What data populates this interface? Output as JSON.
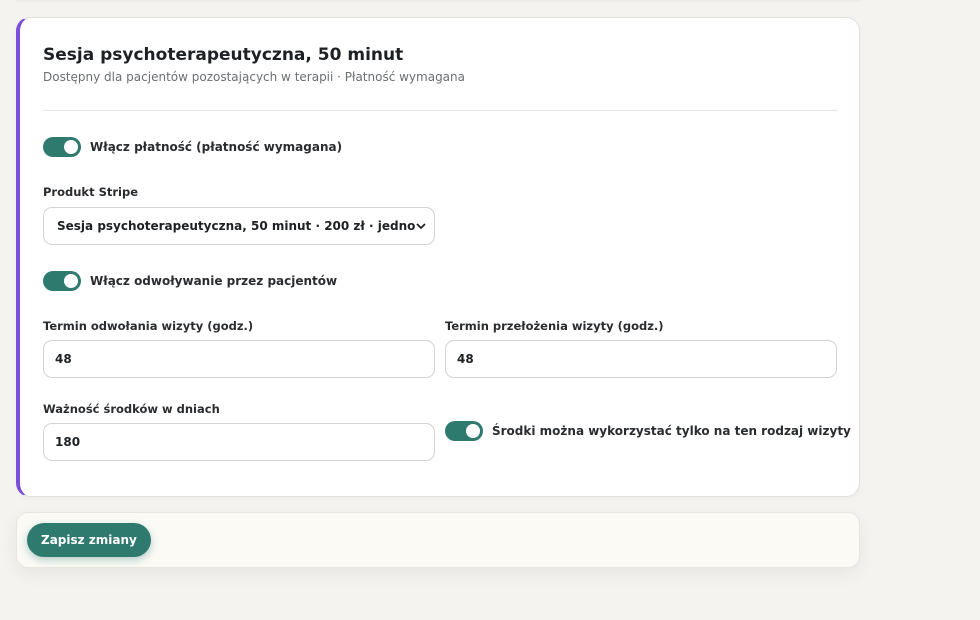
{
  "card": {
    "title": "Sesja psychoterapeutyczna, 50 minut",
    "subtitle": "Dostępny dla pacjentów pozostających w terapii · Płatność wymagana"
  },
  "payment_toggle": {
    "label": "Włącz płatność (płatność wymagana)",
    "on": true
  },
  "stripe_product": {
    "label": "Produkt Stripe",
    "selected": "Sesja psychoterapeutyczna, 50 minut · 200 zł · jednorazow"
  },
  "cancel_toggle": {
    "label": "Włącz odwoływanie przez pacjentów",
    "on": true
  },
  "cancel_deadline": {
    "label": "Termin odwołania wizyty (godz.)",
    "value": "48"
  },
  "reschedule_deadline": {
    "label": "Termin przełożenia wizyty (godz.)",
    "value": "48"
  },
  "credit_validity": {
    "label": "Ważność środków w dniach",
    "value": "180"
  },
  "credit_restrict_toggle": {
    "label": "Środki można wykorzystać tylko na ten rodzaj wizyty",
    "on": true
  },
  "footer": {
    "save_label": "Zapisz zmiany"
  },
  "colors": {
    "accent": "#2f7a6e",
    "card_border_accent": "#7c4ddb"
  }
}
